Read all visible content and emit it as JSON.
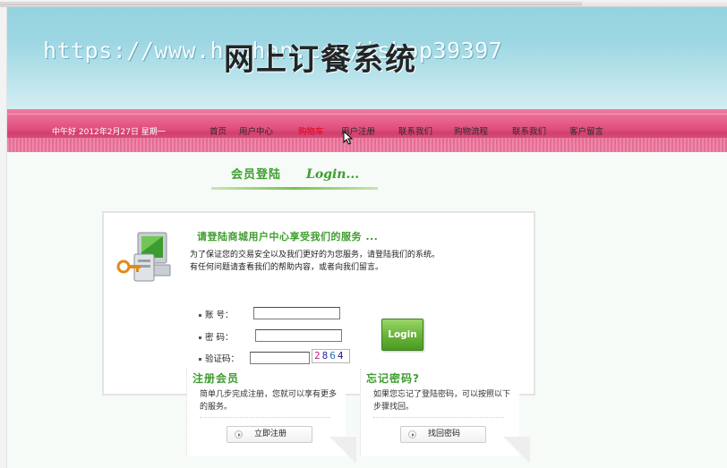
{
  "banner": {
    "watermark": "https://www.huzhan.com/ishop39397",
    "site_title": "网上订餐系统"
  },
  "nav": {
    "greeting": "中午好 2012年2月27日  星期一",
    "items": [
      {
        "label": "首页"
      },
      {
        "label": "用户中心"
      },
      {
        "label": "购物车",
        "active": true
      },
      {
        "label": "用户注册"
      },
      {
        "label": "联系我们"
      },
      {
        "label": "购物流程"
      },
      {
        "label": "联系我们"
      },
      {
        "label": "客户留言"
      }
    ]
  },
  "login_header": {
    "title_cn": "会员登陆",
    "title_en": "Login..."
  },
  "panel": {
    "heading": "请登陆商城用户中心享受我们的服务 ...",
    "desc_line1": "为了保证您的交易安全以及我们更好的为您服务，请登陆我们的系统。",
    "desc_line2": "有任何问题请查看我们的帮助内容，或者向我们留言。"
  },
  "form": {
    "account_label": "账    号：",
    "account_value": "",
    "password_label": "密    码：",
    "password_value": "",
    "captcha_label": "验证码：",
    "captcha_value": "",
    "captcha_digits": [
      "2",
      "8",
      "6",
      "4"
    ],
    "login_button": "Login"
  },
  "register_card": {
    "title": "注册会员",
    "text": "简单几步完成注册，您就可以享有更多的服务。",
    "button": "立即注册"
  },
  "forgot_card": {
    "title": "忘记密码?",
    "text": "如果您忘记了登陆密码，可以按照以下步骤找回。",
    "button": "找回密码"
  },
  "colors": {
    "accent_green": "#3f9d2e",
    "nav_pink": "#e0507e",
    "banner_blue": "#8fd1de",
    "active_red": "#e0001a"
  }
}
